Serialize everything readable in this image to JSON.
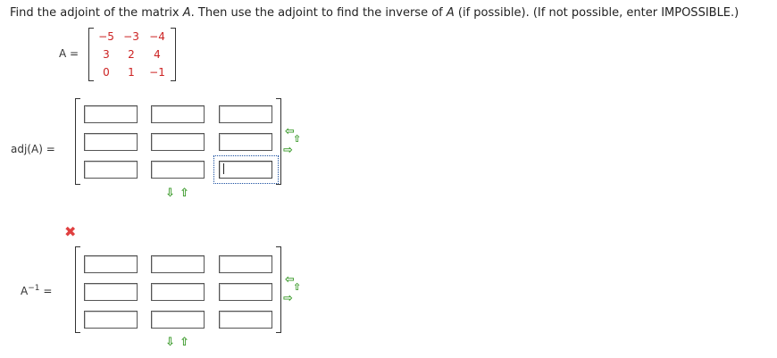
{
  "question": {
    "prefix": "Find the adjoint of the matrix ",
    "var1": "A",
    "middle": ". Then use the adjoint to find the inverse of ",
    "var2": "A",
    "suffix": " (if possible). (If not possible, enter IMPOSSIBLE.)"
  },
  "matrix_label": "A =",
  "matrix": [
    [
      "−5",
      "−3",
      "−4"
    ],
    [
      "3",
      "2",
      "4"
    ],
    [
      "0",
      "1",
      "−1"
    ]
  ],
  "adj_label": "adj(A) =",
  "inv_label_base": "A",
  "inv_label_sup": "−1",
  "inv_label_eq": "=",
  "adj_inputs": [
    "",
    "",
    "",
    "",
    "",
    "",
    "",
    "",
    ""
  ],
  "inv_inputs": [
    "",
    "",
    "",
    "",
    "",
    "",
    "",
    "",
    ""
  ],
  "result_mark": "✖",
  "icons": {
    "add_column_left": "⇦",
    "add_column_right": "⇨",
    "remove_col": "⇩",
    "add_row_up": "⇧",
    "row_down": "⇩",
    "row_up": "⇧"
  },
  "colors": {
    "matrix_numbers": "#cc2222",
    "arrows": "#3a9a2a",
    "wrong": "#e04040",
    "focus": "#1a4fa0"
  }
}
